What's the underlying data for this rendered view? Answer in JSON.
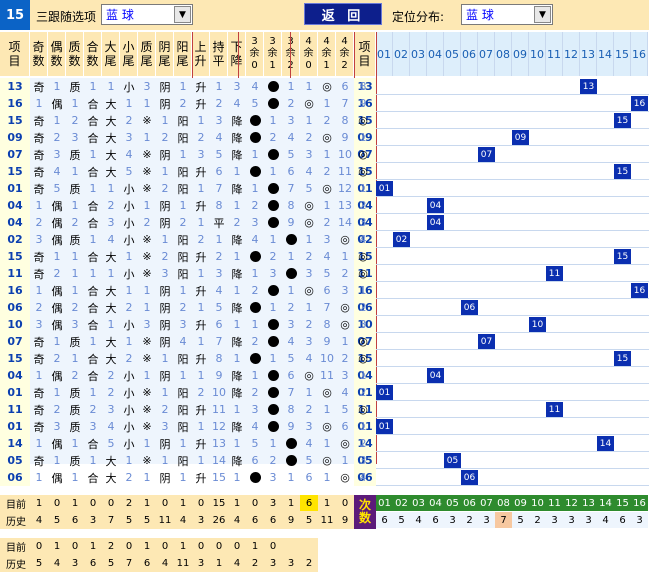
{
  "toolbar": {
    "index": "15",
    "select_label": "三跟随选项",
    "select1_value": "蓝    球",
    "back_label": "返 回",
    "pos_label": "定位分布:",
    "select2_value": "蓝    球"
  },
  "headers": [
    "项目",
    "奇数",
    "偶数",
    "质数",
    "合数",
    "大尾",
    "小尾",
    "质尾",
    "阴尾",
    "阳尾",
    "上升",
    "持平",
    "下降",
    "3余0",
    "3余1",
    "3余2",
    "4余0",
    "4余1",
    "4余2",
    "4余3",
    "项目"
  ],
  "num_headers": [
    "01",
    "02",
    "03",
    "04",
    "05",
    "06",
    "07",
    "08",
    "09",
    "10",
    "11",
    "12",
    "13",
    "14",
    "15",
    "16"
  ],
  "rows": [
    {
      "id": "13",
      "c": [
        "奇",
        "1",
        "质",
        "1",
        "1",
        "小",
        "3",
        "阴",
        "1",
        "升",
        "1",
        "3",
        "4",
        "●",
        "1",
        "1",
        "◎",
        "6",
        "8"
      ],
      "hit": 13
    },
    {
      "id": "16",
      "c": [
        "1",
        "偶",
        "1",
        "合",
        "大",
        "1",
        "1",
        "阴",
        "2",
        "升",
        "2",
        "4",
        "5",
        "●",
        "2",
        "◎",
        "1",
        "7",
        "9"
      ],
      "hit": 16
    },
    {
      "id": "15",
      "c": [
        "奇",
        "1",
        "2",
        "合",
        "大",
        "2",
        "※",
        "1",
        "阳",
        "1",
        "3",
        "降",
        "●",
        "1",
        "3",
        "1",
        "2",
        "8",
        "◎"
      ],
      "hit": 15
    },
    {
      "id": "09",
      "c": [
        "奇",
        "2",
        "3",
        "合",
        "大",
        "3",
        "1",
        "2",
        "阳",
        "2",
        "4",
        "降",
        "●",
        "2",
        "4",
        "2",
        "◎",
        "9",
        "1"
      ],
      "hit": 9
    },
    {
      "id": "07",
      "c": [
        "奇",
        "3",
        "质",
        "1",
        "大",
        "4",
        "※",
        "阴",
        "1",
        "3",
        "5",
        "降",
        "1",
        "●",
        "5",
        "3",
        "1",
        "10",
        "◎"
      ],
      "hit": 7
    },
    {
      "id": "15",
      "c": [
        "奇",
        "4",
        "1",
        "合",
        "大",
        "5",
        "※",
        "1",
        "阳",
        "升",
        "6",
        "1",
        "●",
        "1",
        "6",
        "4",
        "2",
        "11",
        "◎"
      ],
      "hit": 15
    },
    {
      "id": "01",
      "c": [
        "奇",
        "5",
        "质",
        "1",
        "1",
        "小",
        "※",
        "2",
        "阳",
        "1",
        "7",
        "降",
        "1",
        "●",
        "7",
        "5",
        "◎",
        "12",
        "1"
      ],
      "hit": 1
    },
    {
      "id": "04",
      "c": [
        "1",
        "偶",
        "1",
        "合",
        "2",
        "小",
        "1",
        "阴",
        "1",
        "升",
        "8",
        "1",
        "2",
        "●",
        "8",
        "◎",
        "1",
        "13",
        "2"
      ],
      "hit": 4
    },
    {
      "id": "04",
      "c": [
        "2",
        "偶",
        "2",
        "合",
        "3",
        "小",
        "2",
        "阴",
        "2",
        "1",
        "平",
        "2",
        "3",
        "●",
        "9",
        "◎",
        "2",
        "14",
        "3"
      ],
      "hit": 4
    },
    {
      "id": "02",
      "c": [
        "3",
        "偶",
        "质",
        "1",
        "4",
        "小",
        "※",
        "1",
        "阳",
        "2",
        "1",
        "降",
        "4",
        "1",
        "●",
        "1",
        "3",
        "◎",
        "4"
      ],
      "hit": 2
    },
    {
      "id": "15",
      "c": [
        "奇",
        "1",
        "1",
        "合",
        "大",
        "1",
        "※",
        "2",
        "阳",
        "升",
        "2",
        "1",
        "●",
        "2",
        "1",
        "2",
        "4",
        "1",
        "◎"
      ],
      "hit": 15
    },
    {
      "id": "11",
      "c": [
        "奇",
        "2",
        "1",
        "1",
        "1",
        "小",
        "※",
        "3",
        "阳",
        "1",
        "3",
        "降",
        "1",
        "3",
        "●",
        "3",
        "5",
        "2",
        "◎"
      ],
      "hit": 11
    },
    {
      "id": "16",
      "c": [
        "1",
        "偶",
        "1",
        "合",
        "大",
        "1",
        "1",
        "阴",
        "1",
        "升",
        "4",
        "1",
        "2",
        "●",
        "1",
        "◎",
        "6",
        "3",
        "1"
      ],
      "hit": 16
    },
    {
      "id": "06",
      "c": [
        "2",
        "偶",
        "2",
        "合",
        "大",
        "2",
        "1",
        "阴",
        "2",
        "1",
        "5",
        "降",
        "●",
        "1",
        "2",
        "1",
        "7",
        "◎",
        "2"
      ],
      "hit": 6
    },
    {
      "id": "10",
      "c": [
        "3",
        "偶",
        "3",
        "合",
        "1",
        "小",
        "3",
        "阴",
        "3",
        "升",
        "6",
        "1",
        "1",
        "●",
        "3",
        "2",
        "8",
        "◎",
        "3"
      ],
      "hit": 10
    },
    {
      "id": "07",
      "c": [
        "奇",
        "1",
        "质",
        "1",
        "大",
        "1",
        "※",
        "阴",
        "4",
        "1",
        "7",
        "降",
        "2",
        "●",
        "4",
        "3",
        "9",
        "1",
        "◎"
      ],
      "hit": 7
    },
    {
      "id": "15",
      "c": [
        "奇",
        "2",
        "1",
        "合",
        "大",
        "2",
        "※",
        "1",
        "阳",
        "升",
        "8",
        "1",
        "●",
        "1",
        "5",
        "4",
        "10",
        "2",
        "◎"
      ],
      "hit": 15
    },
    {
      "id": "04",
      "c": [
        "1",
        "偶",
        "2",
        "合",
        "2",
        "小",
        "1",
        "阴",
        "1",
        "1",
        "9",
        "降",
        "1",
        "●",
        "6",
        "◎",
        "11",
        "3",
        "1"
      ],
      "hit": 4
    },
    {
      "id": "01",
      "c": [
        "奇",
        "1",
        "质",
        "1",
        "2",
        "小",
        "※",
        "1",
        "阳",
        "2",
        "10",
        "降",
        "2",
        "●",
        "7",
        "1",
        "◎",
        "4",
        "2"
      ],
      "hit": 1
    },
    {
      "id": "11",
      "c": [
        "奇",
        "2",
        "质",
        "2",
        "3",
        "小",
        "※",
        "2",
        "阳",
        "升",
        "11",
        "1",
        "3",
        "●",
        "8",
        "2",
        "1",
        "5",
        "◎"
      ],
      "hit": 11
    },
    {
      "id": "01",
      "c": [
        "奇",
        "3",
        "质",
        "3",
        "4",
        "小",
        "※",
        "3",
        "阳",
        "1",
        "12",
        "降",
        "4",
        "●",
        "9",
        "3",
        "◎",
        "6",
        "1"
      ],
      "hit": 1
    },
    {
      "id": "14",
      "c": [
        "1",
        "偶",
        "1",
        "合",
        "5",
        "小",
        "1",
        "阴",
        "1",
        "升",
        "13",
        "1",
        "5",
        "1",
        "●",
        "4",
        "1",
        "◎",
        "2"
      ],
      "hit": 14
    },
    {
      "id": "05",
      "c": [
        "奇",
        "1",
        "质",
        "1",
        "大",
        "1",
        "※",
        "1",
        "阳",
        "1",
        "14",
        "降",
        "6",
        "2",
        "●",
        "5",
        "◎",
        "1",
        "3"
      ],
      "hit": 5
    },
    {
      "id": "06",
      "c": [
        "1",
        "偶",
        "1",
        "合",
        "大",
        "2",
        "1",
        "阴",
        "1",
        "升",
        "15",
        "1",
        "●",
        "3",
        "1",
        "6",
        "1",
        "◎",
        "4"
      ],
      "hit": 6
    }
  ],
  "footer": {
    "row1_label": "目前",
    "row1": [
      "1",
      "0",
      "1",
      "0",
      "0",
      "2",
      "1",
      "0",
      "1",
      "0",
      "15",
      "1",
      "0",
      "3",
      "1",
      "6",
      "1",
      "0",
      "4"
    ],
    "row2_label": "历史",
    "row2": [
      "4",
      "5",
      "6",
      "3",
      "7",
      "5",
      "5",
      "11",
      "4",
      "3",
      "26",
      "4",
      "6",
      "6",
      "9",
      "5",
      "11",
      "9",
      "9"
    ],
    "cishu_label": "次数",
    "num_headers": [
      "01",
      "02",
      "03",
      "04",
      "05",
      "06",
      "07",
      "08",
      "09",
      "10",
      "11",
      "12",
      "13",
      "14",
      "15",
      "16"
    ],
    "cishu": [
      "6",
      "5",
      "4",
      "6",
      "3",
      "2",
      "3",
      "7",
      "5",
      "2",
      "3",
      "3",
      "3",
      "4",
      "6",
      "3"
    ],
    "row3_label": "目前",
    "row3": [
      "0",
      "1",
      "0",
      "1",
      "2",
      "0",
      "1",
      "0",
      "1",
      "0",
      "0",
      "0",
      "1",
      "0"
    ],
    "row4_label": "历史",
    "row4": [
      "5",
      "4",
      "3",
      "6",
      "5",
      "7",
      "6",
      "4",
      "11",
      "3",
      "1",
      "4",
      "2",
      "3",
      "3",
      "2"
    ]
  }
}
